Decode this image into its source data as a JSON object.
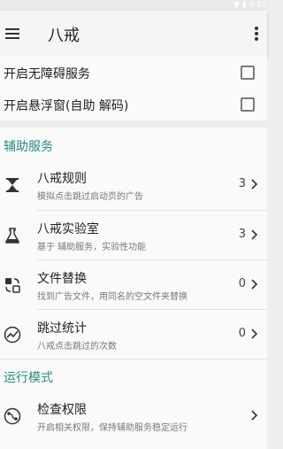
{
  "status_bar": {
    "time": "5:05"
  },
  "toolbar": {
    "title": "八戒",
    "menu_icon": "hamburger-icon",
    "more_icon": "more-vert-icon"
  },
  "toggles": [
    {
      "label": "开启无障碍服务",
      "checked": false
    },
    {
      "label": "开启悬浮窗(自助 解码)",
      "checked": false
    }
  ],
  "sections": {
    "assist": {
      "header": "辅助服务",
      "items": [
        {
          "title": "八戒规则",
          "subtitle": "模拟点击跳过启动页的广告",
          "count": "3",
          "icon": "hourglass-icon"
        },
        {
          "title": "八戒实验室",
          "subtitle": "基于 辅助服务，实验性功能",
          "count": "3",
          "icon": "flask-icon"
        },
        {
          "title": "文件替换",
          "subtitle": "找到广告文件，用同名的空文件夹替换",
          "count": "0",
          "icon": "swap-icon"
        },
        {
          "title": "跳过统计",
          "subtitle": "八戒点击跳过的次数",
          "count": "0",
          "icon": "trend-icon"
        }
      ]
    },
    "mode": {
      "header": "运行模式",
      "items": [
        {
          "title": "检查权限",
          "subtitle": "开启相关权限，保持辅助服务稳定运行",
          "count": "",
          "icon": "route-icon"
        }
      ]
    }
  },
  "colors": {
    "accent": "#2a8a82",
    "background": "#eeeeee",
    "card": "#fafafa"
  }
}
